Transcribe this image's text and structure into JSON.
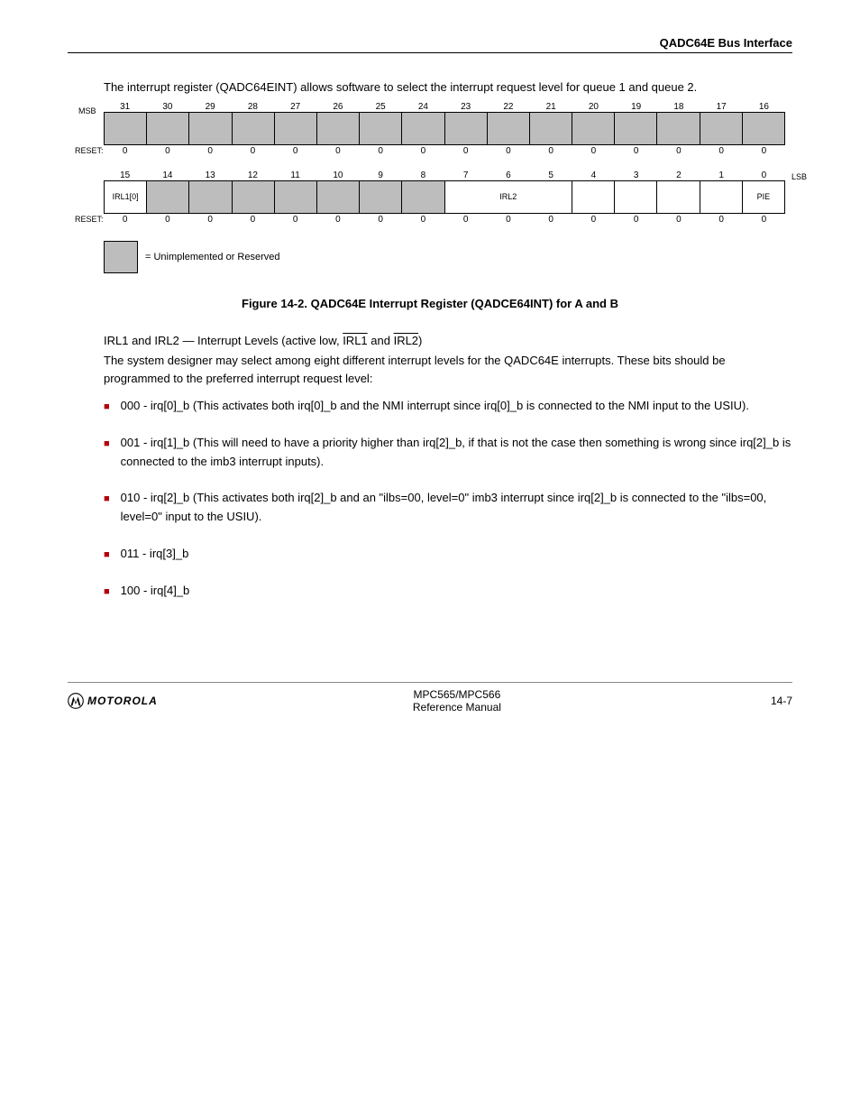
{
  "header": {
    "right": "QADC64E Bus Interface"
  },
  "intro": "The interrupt register (QADC64EINT) allows software to select the interrupt request level for queue 1 and queue 2.",
  "bitRowTop": {
    "msb": "MSB",
    "lsb": "LSB",
    "bits": [
      "31",
      "30",
      "29",
      "28",
      "27",
      "26",
      "25",
      "24",
      "23",
      "22",
      "21",
      "20",
      "19",
      "18",
      "17",
      "16"
    ],
    "resetLabel": "RESET:",
    "resets": [
      "0",
      "0",
      "0",
      "0",
      "0",
      "0",
      "0",
      "0",
      "0",
      "0",
      "0",
      "0",
      "0",
      "0",
      "0",
      "0"
    ]
  },
  "bitRowBottom": {
    "bits": [
      "15",
      "14",
      "13",
      "12",
      "11",
      "10",
      "9",
      "8",
      "7",
      "6",
      "5",
      "4",
      "3",
      "2",
      "1",
      "0"
    ],
    "fields": {
      "irl1_0": "IRL1[0]",
      "irl2": "IRL2",
      "pie": "PIE"
    },
    "resetLabel": "RESET:",
    "resets": [
      "0",
      "0",
      "0",
      "0",
      "0",
      "0",
      "0",
      "0",
      "0",
      "0",
      "0",
      "0",
      "0",
      "0",
      "0",
      "0"
    ]
  },
  "legend": "= Unimplemented or Reserved",
  "figureCaption": "Figure 14-2. QADC64E Interrupt Register (QADCE64INT) for A and B",
  "field": {
    "heading_pre": "IRL1 and IRL2 — Interrupt Levels (active low, ",
    "heading_irl1": "IRL1",
    "heading_and": " and ",
    "heading_irl2": "IRL2",
    "heading_post": ")",
    "desc": "The system designer may select among eight different interrupt levels for the QADC64E interrupts. These bits should be programmed to the preferred interrupt request level:"
  },
  "options": [
    "000 - irq[0]_b (This activates both irq[0]_b and the NMI interrupt since irq[0]_b is connected to the NMI input to the USIU).",
    "001 - irq[1]_b (This will need to have a priority higher than irq[2]_b, if that is not the case then something is wrong since irq[2]_b is connected to the imb3 interrupt inputs).",
    "010 - irq[2]_b (This activates both irq[2]_b and an \"ilbs=00, level=0\" imb3 interrupt since irq[2]_b is connected to the \"ilbs=00, level=0\" input to the USIU).",
    "011 - irq[3]_b",
    "100 - irq[4]_b"
  ],
  "footer": {
    "product": "MPC565/MPC566",
    "doc": "Reference Manual",
    "page": "14-7"
  }
}
